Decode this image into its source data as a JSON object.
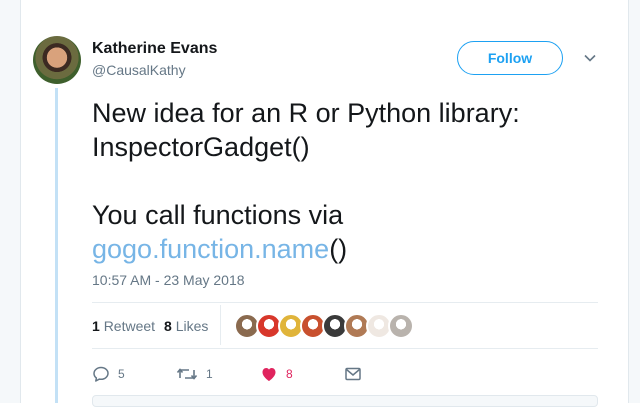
{
  "author": {
    "name": "Katherine Evans",
    "handle": "@CausalKathy"
  },
  "follow_label": "Follow",
  "tweet": {
    "line1": "New idea for an R or Python library:",
    "line2": "InspectorGadget()",
    "line3": "You call functions via",
    "link_text": "gogo.function.name",
    "link_suffix": "()"
  },
  "timestamp": "10:57 AM - 23 May 2018",
  "stats": {
    "retweets_count": "1",
    "retweets_label": "Retweet",
    "likes_count": "8",
    "likes_label": "Likes"
  },
  "likers": [
    {
      "icon": "avatar-bearded-man",
      "color": "#8a6a4f"
    },
    {
      "icon": "avatar-red-circle",
      "color": "#d8372b"
    },
    {
      "icon": "avatar-yellow-person",
      "color": "#e0b43a"
    },
    {
      "icon": "avatar-red-orange",
      "color": "#c8502e"
    },
    {
      "icon": "avatar-dark-dog",
      "color": "#3a3a3a"
    },
    {
      "icon": "avatar-man-face",
      "color": "#b07a55"
    },
    {
      "icon": "avatar-white-feather",
      "color": "#efe8e2"
    },
    {
      "icon": "avatar-cartoon-gray",
      "color": "#b9b3ad"
    }
  ],
  "actions": {
    "replies": "5",
    "retweets": "1",
    "likes": "8"
  },
  "colors": {
    "accent": "#1da1f2",
    "link": "#77b5e6",
    "like": "#e0245e",
    "muted": "#657786"
  }
}
